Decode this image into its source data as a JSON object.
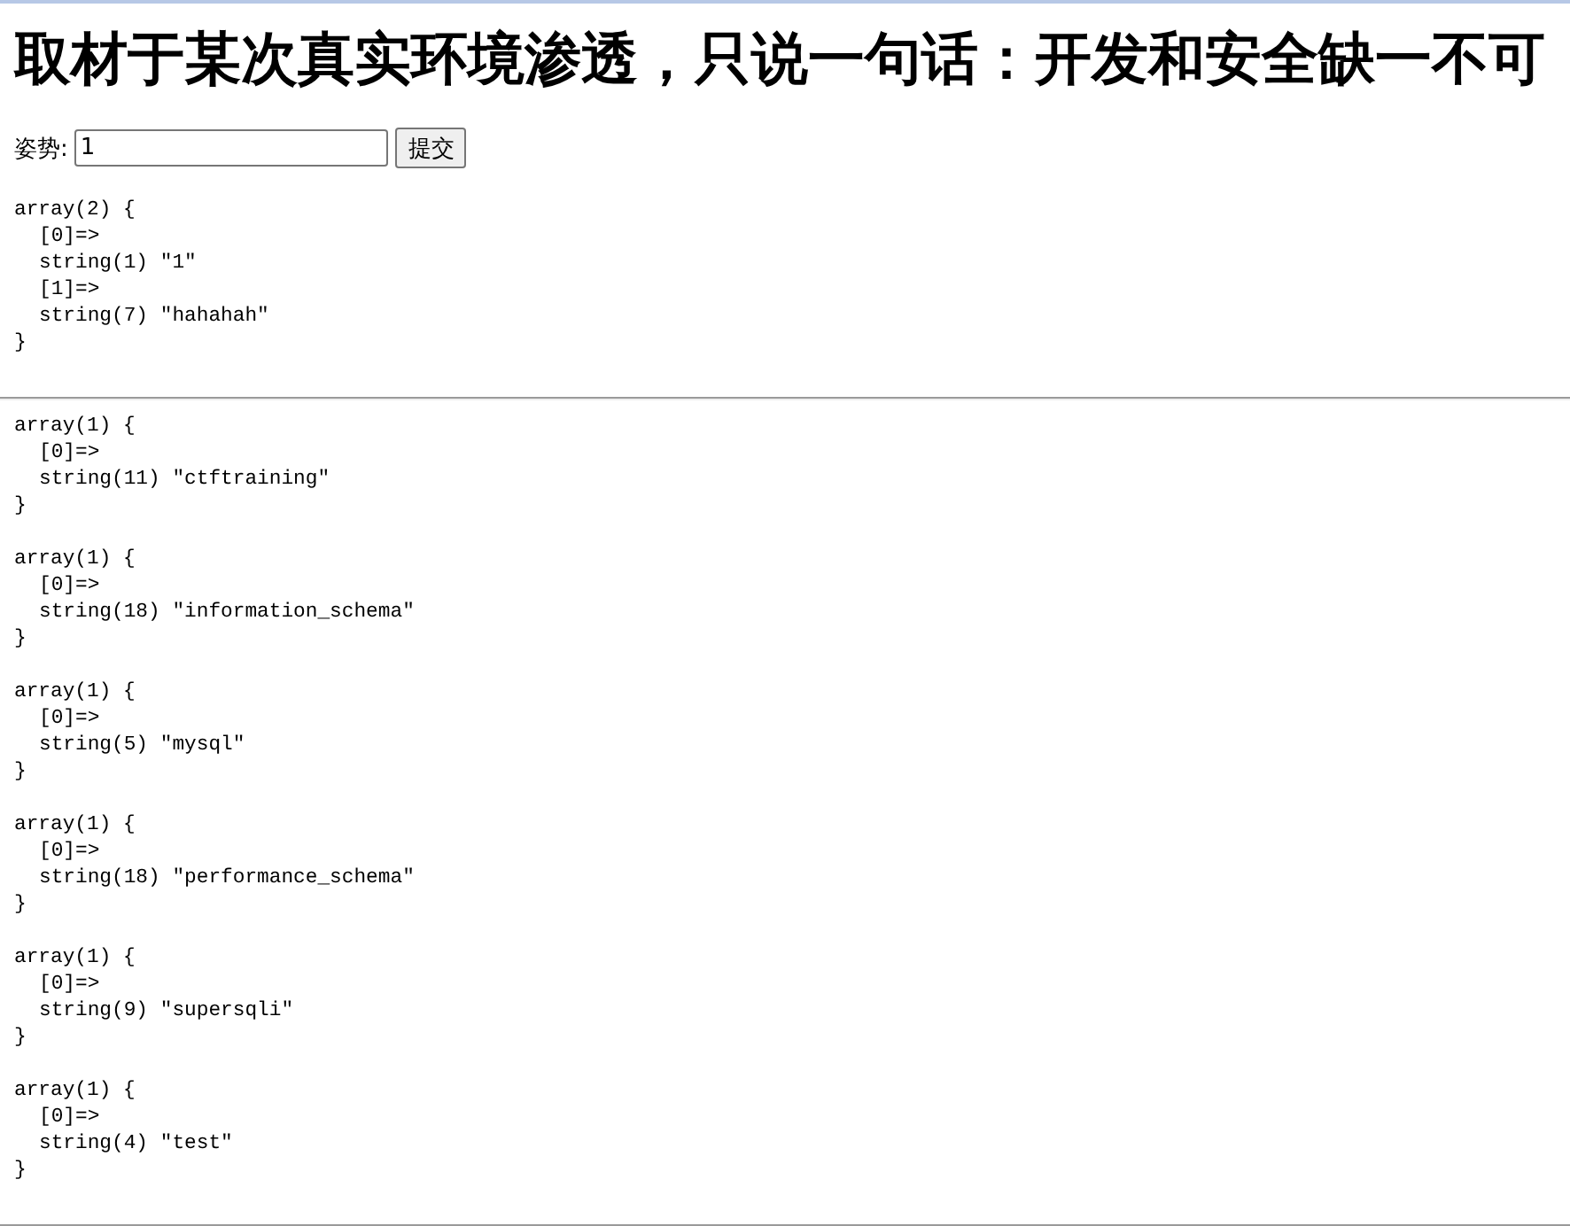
{
  "title": "取材于某次真实环境渗透，只说一句话：开发和安全缺一不可",
  "form": {
    "label": "姿势:",
    "input": {
      "value": "1"
    },
    "submit": "提交"
  },
  "output": {
    "open": "array(2) {",
    "children": [
      "[0]=>",
      "string(1) \"1\"",
      "[1]=>",
      "string(7) \"hahahah\""
    ],
    "close": "}"
  },
  "results": [
    {
      "open": "array(1) {",
      "children": [
        "[0]=>",
        "string(11) \"ctftraining\""
      ],
      "close": "}"
    },
    {
      "open": "array(1) {",
      "children": [
        "[0]=>",
        "string(18) \"information_schema\""
      ],
      "close": "}"
    },
    {
      "open": "array(1) {",
      "children": [
        "[0]=>",
        "string(5) \"mysql\""
      ],
      "close": "}"
    },
    {
      "open": "array(1) {",
      "children": [
        "[0]=>",
        "string(18) \"performance_schema\""
      ],
      "close": "}"
    },
    {
      "open": "array(1) {",
      "children": [
        "[0]=>",
        "string(9) \"supersqli\""
      ],
      "close": "}"
    },
    {
      "open": "array(1) {",
      "children": [
        "[0]=>",
        "string(4) \"test\""
      ],
      "close": "}"
    }
  ]
}
